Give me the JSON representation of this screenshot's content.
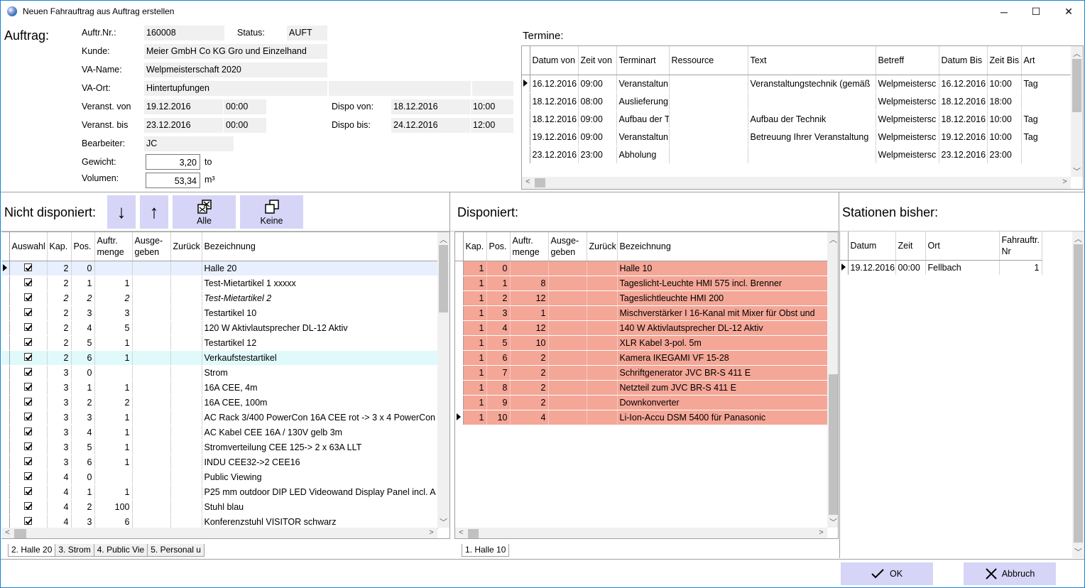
{
  "window": {
    "title": "Neuen Fahrauftrag aus Auftrag erstellen",
    "minimize": "─",
    "maximize": "☐",
    "close": "✕"
  },
  "auftrag": {
    "heading": "Auftrag:",
    "nr_label": "Auftr.Nr.:",
    "nr": "160008",
    "status_label": "Status:",
    "status": "AUFT",
    "kunde_label": "Kunde:",
    "kunde": "Meier GmbH  Co KG Gro und Einzelhand",
    "vaname_label": "VA-Name:",
    "vaname": "Welpmeisterschaft 2020",
    "vaort_label": "VA-Ort:",
    "vaort": "Hintertupfungen",
    "von_label": "Veranst. von",
    "von_date": "19.12.2016",
    "von_time": "00:00",
    "bis_label": "Veranst. bis",
    "bis_date": "23.12.2016",
    "bis_time": "00:00",
    "dispo_von_label": "Dispo von:",
    "dispo_von_date": "18.12.2016",
    "dispo_von_time": "10:00",
    "dispo_bis_label": "Dispo bis:",
    "dispo_bis_date": "24.12.2016",
    "dispo_bis_time": "12:00",
    "bearbeiter_label": "Bearbeiter:",
    "bearbeiter": "JC",
    "gewicht_label": "Gewicht:",
    "gewicht": "3,20",
    "gewicht_unit": "to",
    "volumen_label": "Volumen:",
    "volumen": "53,34",
    "volumen_unit": "m³"
  },
  "termine": {
    "heading": "Termine:",
    "columns": [
      "Datum von",
      "Zeit von",
      "Terminart",
      "Ressource",
      "Text",
      "Betreff",
      "Datum Bis",
      "Zeit Bis",
      "Art"
    ],
    "rows": [
      [
        "16.12.2016",
        "09:00",
        "Veranstaltun",
        "",
        "Veranstaltungstechnik (gemäß",
        "Welpmeistersc",
        "16.12.2016",
        "10:00",
        "Tag"
      ],
      [
        "18.12.2016",
        "08:00",
        "Auslieferung",
        "",
        "",
        "Welpmeistersc",
        "18.12.2016",
        "18:00",
        ""
      ],
      [
        "18.12.2016",
        "09:00",
        "Aufbau der T",
        "",
        "Aufbau der Technik",
        "Welpmeistersc",
        "18.12.2016",
        "10:00",
        "Tag"
      ],
      [
        "19.12.2016",
        "09:00",
        "Veranstaltun",
        "",
        "Betreuung Ihrer Veranstaltung",
        "Welpmeistersc",
        "19.12.2016",
        "10:00",
        "Tag"
      ],
      [
        "23.12.2016",
        "23:00",
        "Abholung",
        "",
        "",
        "Welpmeistersc",
        "23.12.2016",
        "23:00",
        ""
      ]
    ]
  },
  "nicht": {
    "heading": "Nicht disponiert:",
    "btn_down": "↓",
    "btn_up": "↑",
    "btn_alle": "Alle",
    "btn_keine": "Keine",
    "columns": [
      "Auswahl",
      "Kap.",
      "Pos.",
      "Auftr. menge",
      "Ausge- geben",
      "Zurück",
      "Bezeichnung"
    ],
    "rows": [
      [
        "✓",
        "2",
        "0",
        "",
        "",
        "",
        "Halle 20"
      ],
      [
        "✓",
        "2",
        "1",
        "1",
        "",
        "",
        "Test-Mietartikel 1 xxxxx"
      ],
      [
        "✓",
        "2",
        "2",
        "2",
        "",
        "",
        "Test-Mietartikel 2"
      ],
      [
        "✓",
        "2",
        "3",
        "3",
        "",
        "",
        "Testartikel 10"
      ],
      [
        "✓",
        "2",
        "4",
        "5",
        "",
        "",
        "120 W Aktivlautsprecher DL-12 Aktiv"
      ],
      [
        "✓",
        "2",
        "5",
        "1",
        "",
        "",
        "Testartikel 12"
      ],
      [
        "✓",
        "2",
        "6",
        "1",
        "",
        "",
        "Verkaufstestartikel"
      ],
      [
        "✓",
        "3",
        "0",
        "",
        "",
        "",
        "Strom"
      ],
      [
        "✓",
        "3",
        "1",
        "1",
        "",
        "",
        "16A CEE, 4m"
      ],
      [
        "✓",
        "3",
        "2",
        "2",
        "",
        "",
        "16A CEE, 100m"
      ],
      [
        "✓",
        "3",
        "3",
        "1",
        "",
        "",
        "AC Rack 3/400 PowerCon 16A CEE rot -> 3 x 4 PowerCon"
      ],
      [
        "✓",
        "3",
        "4",
        "1",
        "",
        "",
        "AC Kabel CEE 16A / 130V gelb 3m"
      ],
      [
        "✓",
        "3",
        "5",
        "1",
        "",
        "",
        "Stromverteilung CEE 125-> 2 x 63A LLT"
      ],
      [
        "✓",
        "3",
        "6",
        "1",
        "",
        "",
        "INDU CEE32->2 CEE16"
      ],
      [
        "✓",
        "4",
        "0",
        "",
        "",
        "",
        "Public Viewing"
      ],
      [
        "✓",
        "4",
        "1",
        "1",
        "",
        "",
        "P25 mm outdoor DIP LED Videowand Display Panel incl. A"
      ],
      [
        "✓",
        "4",
        "2",
        "100",
        "",
        "",
        "Stuhl blau"
      ],
      [
        "✓",
        "4",
        "3",
        "6",
        "",
        "",
        "Konferenzstuhl VISITOR schwarz"
      ]
    ],
    "tabs": [
      "2. Halle 20",
      "3. Strom",
      "4. Public Vie",
      "5. Personal u"
    ]
  },
  "disponiert": {
    "heading": "Disponiert:",
    "columns": [
      "Kap.",
      "Pos.",
      "Auftr. menge",
      "Ausge- geben",
      "Zurück",
      "Bezeichnung"
    ],
    "rows": [
      [
        "1",
        "0",
        "",
        "",
        "",
        "Halle 10"
      ],
      [
        "1",
        "1",
        "8",
        "",
        "",
        "Tageslicht-Leuchte HMI 575 incl. Brenner"
      ],
      [
        "1",
        "2",
        "12",
        "",
        "",
        "Tageslichtleuchte HMI 200"
      ],
      [
        "1",
        "3",
        "1",
        "",
        "",
        "Mischverstärker I 16-Kanal mit Mixer für Obst und"
      ],
      [
        "1",
        "4",
        "12",
        "",
        "",
        "140 W Aktivlautsprecher DL-12 Aktiv"
      ],
      [
        "1",
        "5",
        "10",
        "",
        "",
        "XLR Kabel 3-pol. 5m"
      ],
      [
        "1",
        "6",
        "2",
        "",
        "",
        "Kamera IKEGAMI VF 15-28"
      ],
      [
        "1",
        "7",
        "2",
        "",
        "",
        "Schriftgenerator JVC BR-S 411 E"
      ],
      [
        "1",
        "8",
        "2",
        "",
        "",
        "Netzteil zum JVC BR-S 411 E"
      ],
      [
        "1",
        "9",
        "2",
        "",
        "",
        "Downkonverter"
      ],
      [
        "1",
        "10",
        "4",
        "",
        "",
        "Li-Ion-Accu DSM 5400 für Panasonic"
      ]
    ],
    "tabs": [
      "1. Halle 10"
    ]
  },
  "stationen": {
    "heading": "Stationen bisher:",
    "columns": [
      "Datum",
      "Zeit",
      "Ort",
      "Fahrauftr. Nr"
    ],
    "rows": [
      [
        "19.12.2016",
        "00:00",
        "Fellbach",
        "1"
      ]
    ]
  },
  "footer": {
    "ok": "OK",
    "abbruch": "Abbruch"
  },
  "colors": {
    "button_bg": "#d6d5f7",
    "dispo_row": "#f4a697",
    "highlight_row": "#e0fafb"
  }
}
